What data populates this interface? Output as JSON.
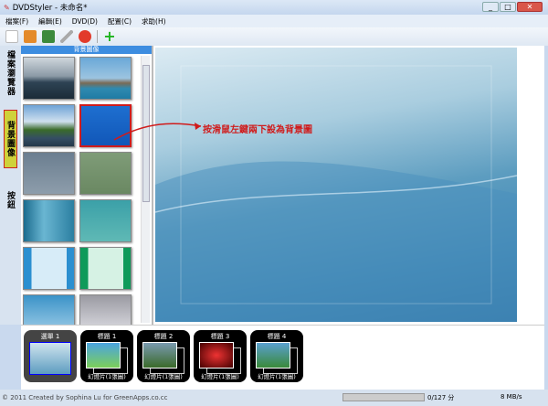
{
  "window": {
    "title": "DVDStyler - 未命名*",
    "min": "_",
    "max": "□",
    "close": "✕"
  },
  "menu": [
    "檔案(F)",
    "編輯(E)",
    "DVD(D)",
    "配置(C)",
    "求助(H)"
  ],
  "toolbar": [
    "new-icon",
    "open-icon",
    "save-icon",
    "settings-icon",
    "burn-icon",
    "add-icon"
  ],
  "side_tabs": [
    "檔案瀏覽器",
    "背景圖像",
    "按鈕"
  ],
  "panel": {
    "title": "背景圖像",
    "thumbs": [
      "linear-gradient(#cfd6dc 0%,#8b9aa6 45%,#2e4354 60%,#1c2b38 100%)",
      "linear-gradient(#6aa8d8 0%,#9cc4e0 50%,#7a6a55 62%,#2f8ab0 75%,#1f7ba4 100%)",
      "linear-gradient(#6ea3d6 0%,#cfe0ee 40%,#3a6b2a 60%,#354e63 80%,#24384a 100%)",
      "linear-gradient(#1e6fd0,#1157b8)",
      "linear-gradient(#6b7e90,#8d9dab)",
      "linear-gradient(#7f9c78,#6a8862)",
      "linear-gradient(90deg,#1b6c8e,#6ab6d2 40%,#2b7fa1)",
      "linear-gradient(#3ba0a8,#5fb9b5)",
      "linear-gradient(90deg,#2b8fd0 15%,#d7ecf8 15%,#d7ecf8 85%,#2b8fd0 85%)",
      "linear-gradient(90deg,#0f9a5a 15%,#d6f2e4 15%,#d6f2e4 85%,#0f9a5a 85%)",
      "linear-gradient(#3b93c8,#a8d2ea)",
      "linear-gradient(#9a9aa2,#e4e4ea)"
    ]
  },
  "annotation": "按滑鼠左鍵兩下設為背景圖",
  "titles": [
    {
      "label": "選單 1",
      "foot": ""
    },
    {
      "label": "標題 1",
      "foot": "幻燈片(1張圖)"
    },
    {
      "label": "標題 2",
      "foot": "幻燈片(1張圖)"
    },
    {
      "label": "標題 3",
      "foot": "幻燈片(1張圖)"
    },
    {
      "label": "標題 4",
      "foot": "幻燈片(1張圖)"
    }
  ],
  "status": {
    "credit": "© 2011 Created by Sophina Lu for GreenApps.co.cc",
    "size": "0/127 分",
    "speed": "8 MB/s",
    "progress": 0
  }
}
